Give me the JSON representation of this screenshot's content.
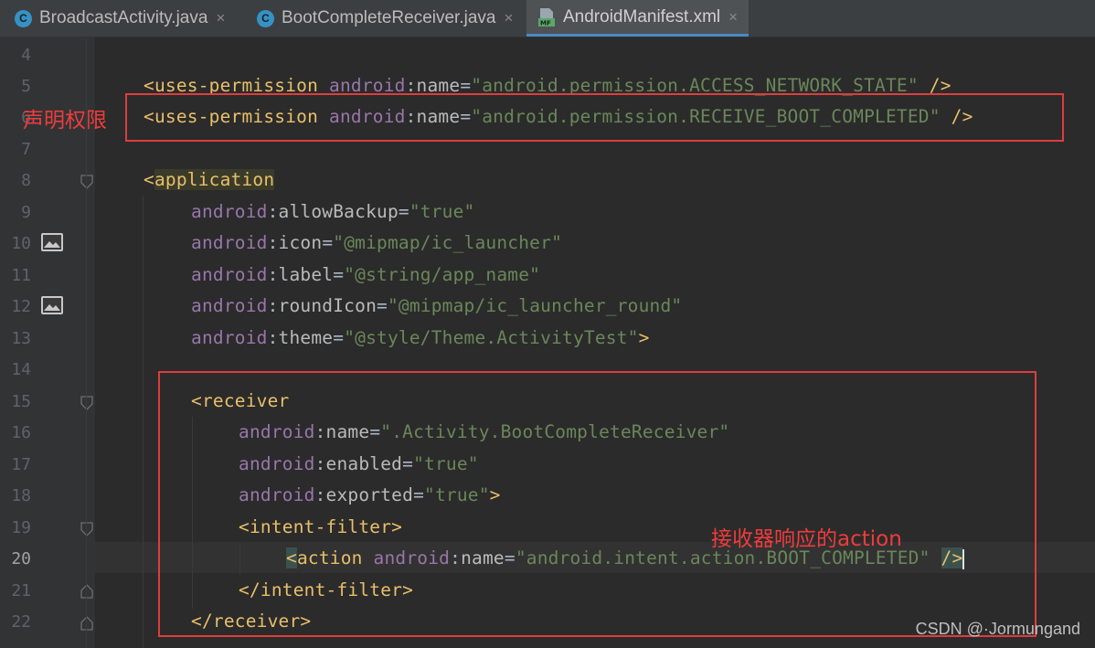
{
  "tabs": [
    {
      "label": "BroadcastActivity.java",
      "icon": "java-class-icon",
      "badge": "C"
    },
    {
      "label": "BootCompleteReceiver.java",
      "icon": "java-class-icon",
      "badge": "C"
    },
    {
      "label": "AndroidManifest.xml",
      "icon": "manifest-file-icon",
      "badge": "MF",
      "active": true
    }
  ],
  "close_glyph": "×",
  "line_numbers": [
    "4",
    "5",
    "6",
    "7",
    "8",
    "9",
    "10",
    "11",
    "12",
    "13",
    "14",
    "15",
    "16",
    "17",
    "18",
    "19",
    "20",
    "21",
    "22"
  ],
  "current_line": "20",
  "code": {
    "l5": {
      "open": "<uses-permission",
      "ns": "android",
      "colon": ":",
      "attr": "name",
      "eq": "=",
      "val": "\"android.permission.ACCESS_NETWORK_STATE\"",
      "close": " />"
    },
    "l6": {
      "open": "<uses-permission",
      "ns": "android",
      "colon": ":",
      "attr": "name",
      "eq": "=",
      "val": "\"android.permission.RECEIVE_BOOT_COMPLETED\"",
      "close": " />"
    },
    "l8": {
      "lt": "<",
      "tag": "application"
    },
    "l9": {
      "ns": "android",
      "colon": ":",
      "attr": "allowBackup",
      "eq": "=",
      "val": "\"true\""
    },
    "l10": {
      "ns": "android",
      "colon": ":",
      "attr": "icon",
      "eq": "=",
      "val": "\"@mipmap/ic_launcher\""
    },
    "l11": {
      "ns": "android",
      "colon": ":",
      "attr": "label",
      "eq": "=",
      "val": "\"@string/app_name\""
    },
    "l12": {
      "ns": "android",
      "colon": ":",
      "attr": "roundIcon",
      "eq": "=",
      "val": "\"@mipmap/ic_launcher_round\""
    },
    "l13": {
      "ns": "android",
      "colon": ":",
      "attr": "theme",
      "eq": "=",
      "val": "\"@style/Theme.ActivityTest\"",
      "close": ">"
    },
    "l15": {
      "open": "<receiver"
    },
    "l16": {
      "ns": "android",
      "colon": ":",
      "attr": "name",
      "eq": "=",
      "val": "\".Activity.BootCompleteReceiver\""
    },
    "l17": {
      "ns": "android",
      "colon": ":",
      "attr": "enabled",
      "eq": "=",
      "val": "\"true\""
    },
    "l18": {
      "ns": "android",
      "colon": ":",
      "attr": "exported",
      "eq": "=",
      "val": "\"true\"",
      "close": ">"
    },
    "l19": {
      "open": "<intent-filter>"
    },
    "l20": {
      "lt": "<",
      "tag": "action",
      "ns": "android",
      "colon": ":",
      "attr": "name",
      "eq": "=",
      "val": "\"android.intent.action.BOOT_COMPLETED\"",
      "close": "/>"
    },
    "l21": {
      "open": "</intent-filter>"
    },
    "l22": {
      "open": "</receiver>"
    }
  },
  "annotations": {
    "permission": "声明权限",
    "action": "接收器响应的action"
  },
  "watermark": "CSDN @·Jormungand",
  "colors": {
    "background": "#2b2b2b",
    "tag": "#e8bf6a",
    "namespace": "#9876aa",
    "string": "#6a8759",
    "annotation_red": "#e03c3c",
    "active_tab_underline": "#4a88c7"
  }
}
